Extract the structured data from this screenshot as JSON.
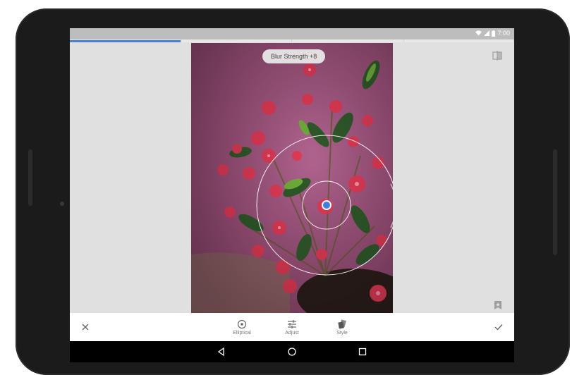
{
  "status_bar": {
    "time": "7:00",
    "icons": [
      "wifi-icon",
      "signal-icon",
      "battery-icon"
    ]
  },
  "tabs": {
    "count": 4,
    "active_index": 0
  },
  "editor": {
    "blur_label": "Blur Strength +8",
    "top_right_icon": "compare-icon",
    "bottom_right_icon": "bookmark-icon"
  },
  "toolbar": {
    "cancel_icon": "close-icon",
    "items": [
      {
        "label": "Elliptical",
        "icon": "elliptical-icon"
      },
      {
        "label": "Adjust",
        "icon": "adjust-icon"
      },
      {
        "label": "Style",
        "icon": "style-icon"
      }
    ],
    "apply_icon": "check-icon"
  },
  "nav": {
    "buttons": [
      "back-icon",
      "home-icon",
      "recents-icon"
    ]
  },
  "colors": {
    "accent": "#4a7fd6",
    "nav_bg": "#000000",
    "screen_bg": "#e0e0e0"
  }
}
